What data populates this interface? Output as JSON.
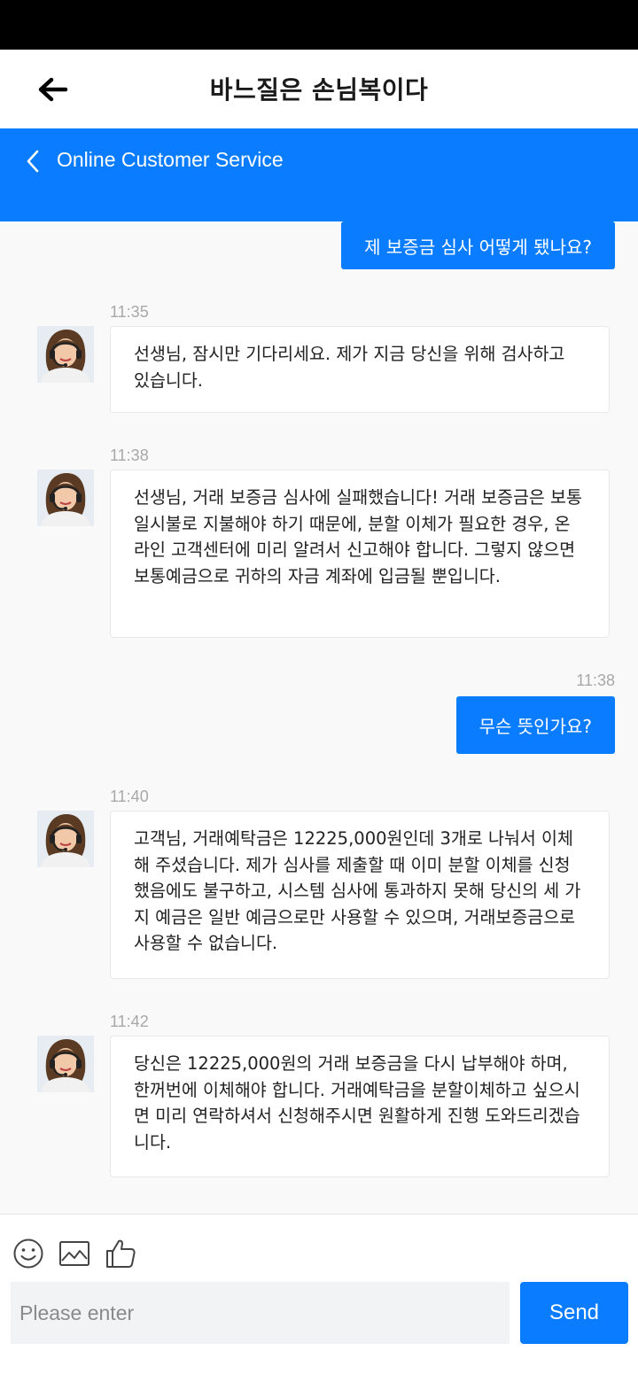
{
  "app": {
    "title": "바느질은 손님복이다"
  },
  "service_header": {
    "title": "Online Customer Service"
  },
  "messages": [
    {
      "side": "right",
      "text": "제 보증금 심사 어떻게 됐나요?"
    },
    {
      "side": "left",
      "time": "11:35",
      "text": "선생님, 잠시만 기다리세요. 제가 지금 당신을 위해 검사하고 있습니다."
    },
    {
      "side": "left",
      "time": "11:38",
      "text": "선생님, 거래 보증금 심사에 실패했습니다! 거래 보증금은 보통 일시불로 지불해야 하기 때문에, 분할 이체가 필요한 경우, 온라인 고객센터에 미리 알려서 신고해야 합니다. 그렇지 않으면 보통예금으로 귀하의 자금 계좌에 입금될 뿐입니다."
    },
    {
      "side": "right",
      "time": "11:38",
      "text": "무슨 뜻인가요?"
    },
    {
      "side": "left",
      "time": "11:40",
      "text": "고객님, 거래예탁금은 12225,000원인데 3개로 나눠서 이체해 주셨습니다. 제가 심사를 제출할 때 이미 분할 이체를 신청했음에도 불구하고, 시스템 심사에 통과하지 못해 당신의 세 가지 예금은 일반 예금으로만 사용할 수 있으며, 거래보증금으로 사용할 수 없습니다."
    },
    {
      "side": "left",
      "time": "11:42",
      "text": "당신은 12225,000원의 거래 보증금을 다시 납부해야 하며, 한꺼번에 이체해야 합니다. 거래예탁금을 분할이체하고 싶으시면 미리 연락하셔서 신청해주시면 원활하게 진행 도와드리겠습니다."
    }
  ],
  "composer": {
    "placeholder": "Please enter",
    "send_label": "Send",
    "tools": [
      "smiley-icon",
      "image-icon",
      "thumbs-up-icon"
    ]
  },
  "colors": {
    "accent": "#0a7cff",
    "chat_bg": "#f9f9f9",
    "timestamp": "#a8a8a8"
  }
}
